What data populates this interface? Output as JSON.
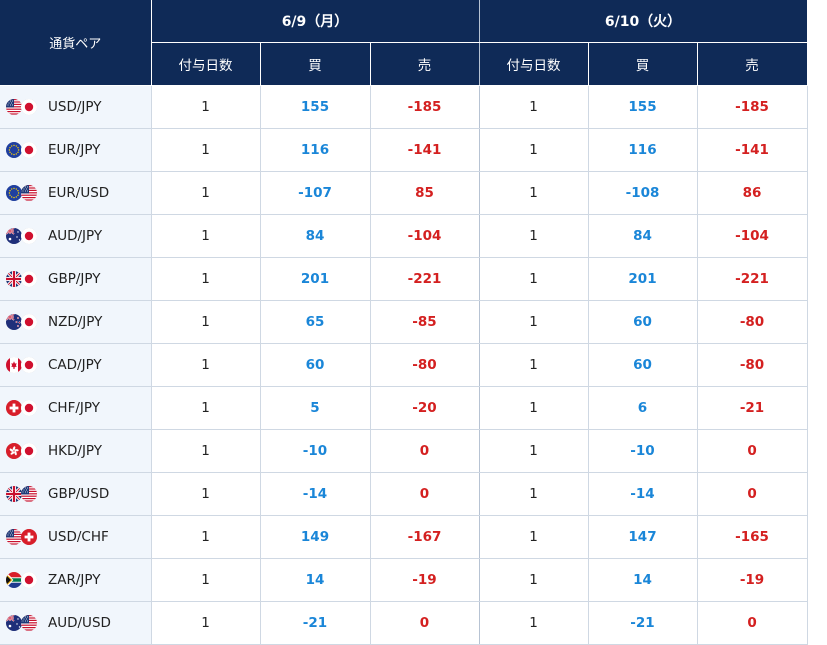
{
  "header": {
    "pair_label": "通貨ペア",
    "day1": "6/9（月）",
    "day2": "6/10（火）",
    "days_label": "付与日数",
    "buy_label": "買",
    "sell_label": "売"
  },
  "rows": [
    {
      "pair": "USD/JPY",
      "flags": [
        "us",
        "jp"
      ],
      "d1": {
        "days": "1",
        "buy": "155",
        "sell": "-185"
      },
      "d2": {
        "days": "1",
        "buy": "155",
        "sell": "-185"
      }
    },
    {
      "pair": "EUR/JPY",
      "flags": [
        "eu",
        "jp"
      ],
      "d1": {
        "days": "1",
        "buy": "116",
        "sell": "-141"
      },
      "d2": {
        "days": "1",
        "buy": "116",
        "sell": "-141"
      }
    },
    {
      "pair": "EUR/USD",
      "flags": [
        "eu",
        "us"
      ],
      "d1": {
        "days": "1",
        "buy": "-107",
        "sell": "85"
      },
      "d2": {
        "days": "1",
        "buy": "-108",
        "sell": "86"
      }
    },
    {
      "pair": "AUD/JPY",
      "flags": [
        "au",
        "jp"
      ],
      "d1": {
        "days": "1",
        "buy": "84",
        "sell": "-104"
      },
      "d2": {
        "days": "1",
        "buy": "84",
        "sell": "-104"
      }
    },
    {
      "pair": "GBP/JPY",
      "flags": [
        "gb",
        "jp"
      ],
      "d1": {
        "days": "1",
        "buy": "201",
        "sell": "-221"
      },
      "d2": {
        "days": "1",
        "buy": "201",
        "sell": "-221"
      }
    },
    {
      "pair": "NZD/JPY",
      "flags": [
        "nz",
        "jp"
      ],
      "d1": {
        "days": "1",
        "buy": "65",
        "sell": "-85"
      },
      "d2": {
        "days": "1",
        "buy": "60",
        "sell": "-80"
      }
    },
    {
      "pair": "CAD/JPY",
      "flags": [
        "ca",
        "jp"
      ],
      "d1": {
        "days": "1",
        "buy": "60",
        "sell": "-80"
      },
      "d2": {
        "days": "1",
        "buy": "60",
        "sell": "-80"
      }
    },
    {
      "pair": "CHF/JPY",
      "flags": [
        "ch",
        "jp"
      ],
      "d1": {
        "days": "1",
        "buy": "5",
        "sell": "-20"
      },
      "d2": {
        "days": "1",
        "buy": "6",
        "sell": "-21"
      }
    },
    {
      "pair": "HKD/JPY",
      "flags": [
        "hk",
        "jp"
      ],
      "d1": {
        "days": "1",
        "buy": "-10",
        "sell": "0"
      },
      "d2": {
        "days": "1",
        "buy": "-10",
        "sell": "0"
      }
    },
    {
      "pair": "GBP/USD",
      "flags": [
        "gb",
        "us"
      ],
      "d1": {
        "days": "1",
        "buy": "-14",
        "sell": "0"
      },
      "d2": {
        "days": "1",
        "buy": "-14",
        "sell": "0"
      }
    },
    {
      "pair": "USD/CHF",
      "flags": [
        "us",
        "ch"
      ],
      "d1": {
        "days": "1",
        "buy": "149",
        "sell": "-167"
      },
      "d2": {
        "days": "1",
        "buy": "147",
        "sell": "-165"
      }
    },
    {
      "pair": "ZAR/JPY",
      "flags": [
        "za",
        "jp"
      ],
      "d1": {
        "days": "1",
        "buy": "14",
        "sell": "-19"
      },
      "d2": {
        "days": "1",
        "buy": "14",
        "sell": "-19"
      }
    },
    {
      "pair": "AUD/USD",
      "flags": [
        "au",
        "us"
      ],
      "d1": {
        "days": "1",
        "buy": "-21",
        "sell": "0"
      },
      "d2": {
        "days": "1",
        "buy": "-21",
        "sell": "0"
      }
    }
  ],
  "colors": {
    "header_bg": "#0f2a57",
    "buy": "#1a86d8",
    "sell": "#d42020",
    "pair_bg": "#f1f6fc"
  }
}
